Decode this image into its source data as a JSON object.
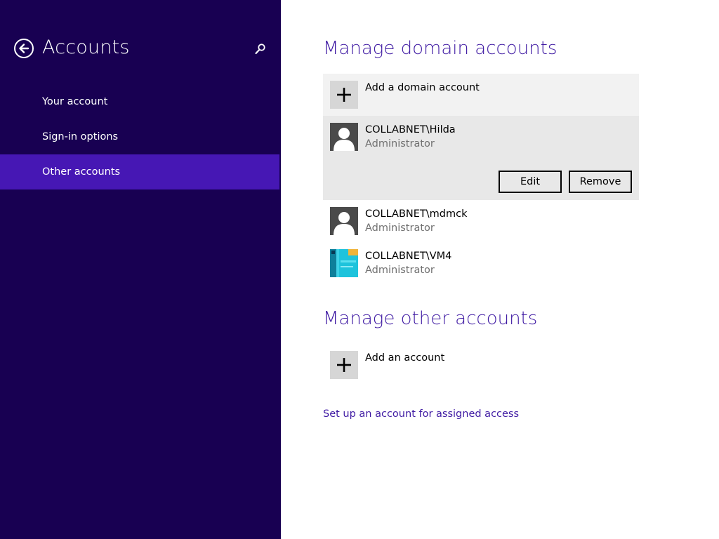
{
  "sidebar": {
    "title": "Accounts",
    "back_icon": "back-arrow-icon",
    "search_icon": "search-icon",
    "items": [
      {
        "label": "Your account"
      },
      {
        "label": "Sign-in options"
      },
      {
        "label": "Other accounts",
        "selected": true
      }
    ]
  },
  "domain": {
    "title": "Manage domain accounts",
    "add_label": "Add a domain account",
    "accounts": [
      {
        "name": "COLLABNET\\Hilda",
        "role": "Administrator",
        "avatar": "user-silhouette-icon",
        "selected": true
      },
      {
        "name": "COLLABNET\\mdmck",
        "role": "Administrator",
        "avatar": "user-silhouette-icon"
      },
      {
        "name": "COLLABNET\\VM4",
        "role": "Administrator",
        "avatar": "user-picture-image"
      }
    ],
    "edit_label": "Edit",
    "remove_label": "Remove"
  },
  "other": {
    "title": "Manage other accounts",
    "add_label": "Add an account"
  },
  "assigned_access_link": "Set up an account for assigned access",
  "colors": {
    "sidebar_bg": "#180052",
    "nav_selected": "#4617b4",
    "accent_text": "#3f1aa3",
    "selected_row_bg": "#e8e8e8",
    "add_row_bg": "#f2f2f2",
    "avatar_bg": "#4a4a4a"
  }
}
